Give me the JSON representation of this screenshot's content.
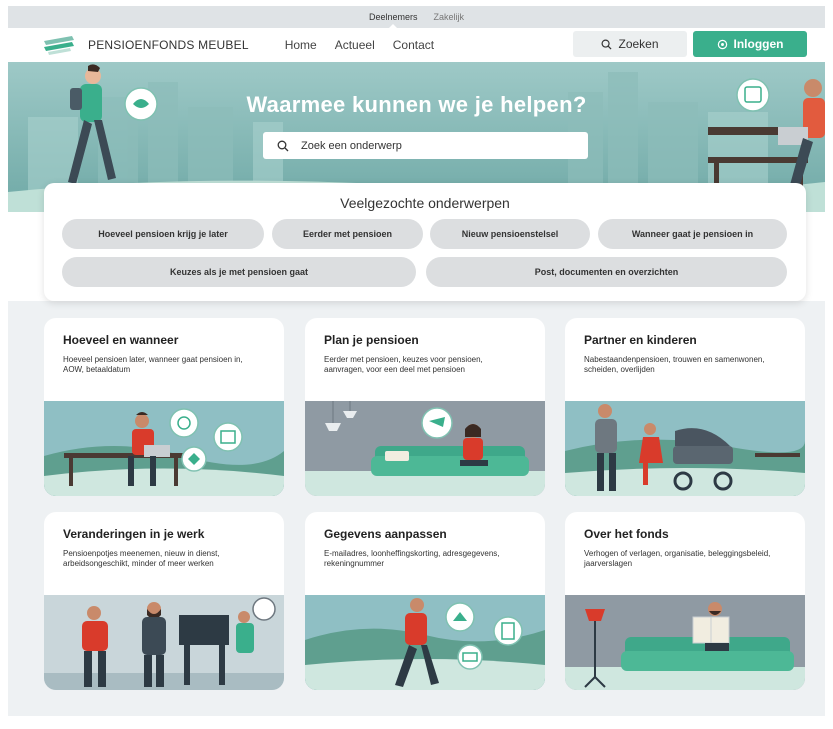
{
  "top_tabs": [
    {
      "label": "Deelnemers",
      "active": true
    },
    {
      "label": "Zakelijk",
      "active": false
    }
  ],
  "header": {
    "logo_text": "PENSIOENFONDS MEUBEL",
    "nav": [
      "Home",
      "Actueel",
      "Contact"
    ],
    "search_label": "Zoeken",
    "login_label": "Inloggen",
    "accent_color": "#3aaf8c"
  },
  "hero": {
    "title": "Waarmee kunnen we je helpen?",
    "search_placeholder": "Zoek een onderwerp"
  },
  "popular": {
    "title": "Veelgezochte onderwerpen",
    "chips": [
      "Hoeveel pensioen krijg je later",
      "Eerder met pensioen",
      "Nieuw pensioenstelsel",
      "Wanneer gaat je pensioen in",
      "Keuzes als je met pensioen gaat",
      "Post, documenten en overzichten"
    ]
  },
  "cards": [
    {
      "title": "Hoeveel en wanneer",
      "text": "Hoeveel pensioen later, wanneer gaat pensioen in, AOW, betaaldatum"
    },
    {
      "title": "Plan je pensioen",
      "text": "Eerder met pensioen, keuzes voor pensioen, aanvragen, voor een deel met pensioen"
    },
    {
      "title": "Partner en kinderen",
      "text": "Nabestaandenpensioen, trouwen en samenwonen, scheiden, overlijden"
    },
    {
      "title": "Veranderingen in je werk",
      "text": "Pensioenpotjes meenemen, nieuw in dienst, arbeidsongeschikt, minder of meer werken"
    },
    {
      "title": "Gegevens aanpassen",
      "text": "E-mailadres, loonheffingskorting, adresgegevens, rekeningnummer"
    },
    {
      "title": "Over het fonds",
      "text": "Verhogen of verlagen, organisatie, beleggingsbeleid, jaarverslagen"
    }
  ]
}
